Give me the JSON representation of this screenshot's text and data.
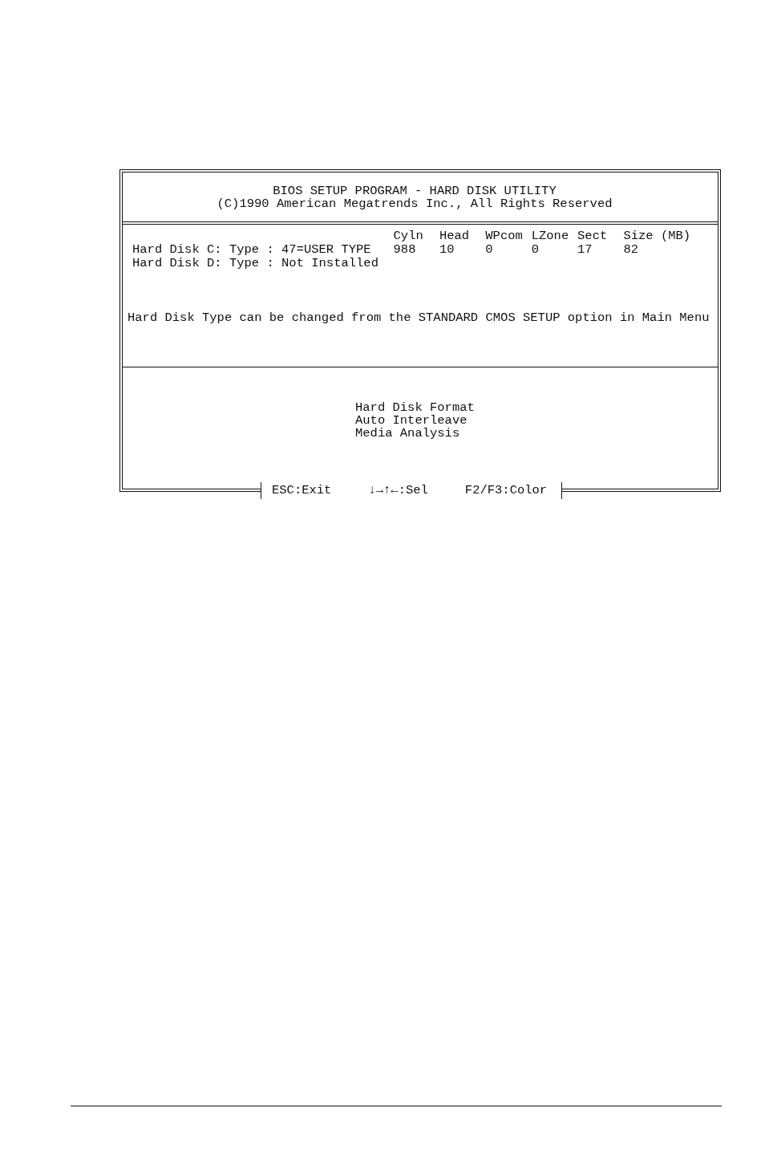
{
  "header": {
    "title": "BIOS SETUP PROGRAM - HARD DISK UTILITY",
    "copyright": "(C)1990 American Megatrends Inc., All Rights Reserved"
  },
  "disks": {
    "columns": [
      "Cyln",
      "Head",
      "WPcom",
      "LZone",
      "Sect",
      "Size (MB)"
    ],
    "rows": [
      {
        "label": "Hard Disk C: Type : 47=USER TYPE",
        "values": [
          "988",
          "10",
          "0",
          "0",
          "17",
          "82"
        ]
      },
      {
        "label": "Hard Disk D: Type : Not Installed"
      }
    ]
  },
  "note": "Hard Disk Type can be changed from the STANDARD CMOS SETUP option in Main Menu",
  "menu": [
    {
      "label": "Hard Disk Format"
    },
    {
      "label": "Auto Interleave"
    },
    {
      "label": "Media Analysis"
    }
  ],
  "key_hints": [
    "ESC:Exit",
    "↓→↑←:Sel",
    "F2/F3:Color"
  ]
}
